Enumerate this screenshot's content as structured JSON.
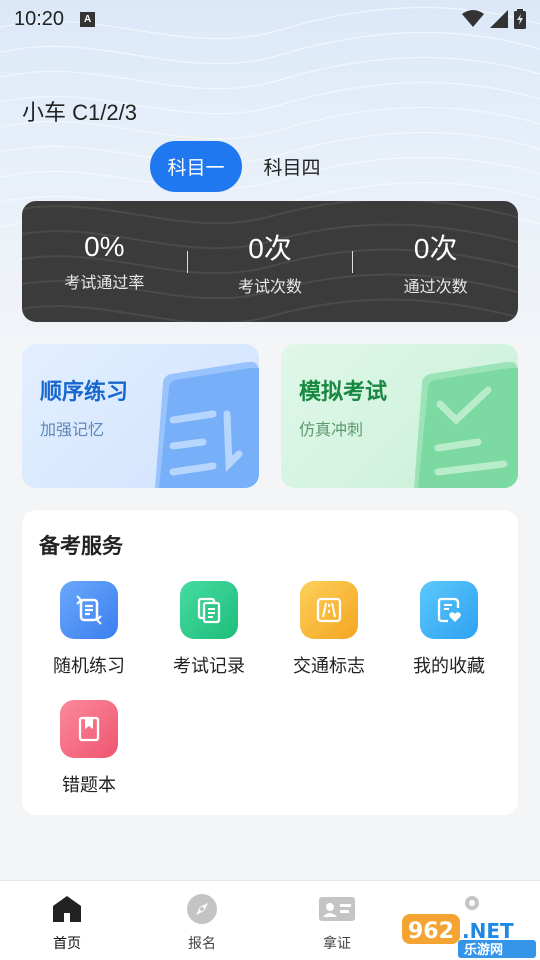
{
  "status_bar": {
    "time": "10:20",
    "notification_letter": "A"
  },
  "header": {
    "license_type": "小车 C1/2/3",
    "subject_tabs": [
      {
        "label": "科目一",
        "active": true
      },
      {
        "label": "科目四",
        "active": false
      }
    ]
  },
  "stats": [
    {
      "value": "0%",
      "label": "考试通过率"
    },
    {
      "value": "0次",
      "label": "考试次数"
    },
    {
      "value": "0次",
      "label": "通过次数"
    }
  ],
  "practice_cards": [
    {
      "title": "顺序练习",
      "subtitle": "加强记忆",
      "theme": "blue"
    },
    {
      "title": "模拟考试",
      "subtitle": "仿真冲刺",
      "theme": "green"
    }
  ],
  "services": {
    "heading": "备考服务",
    "items": [
      {
        "label": "随机练习",
        "icon": "shuffle-icon",
        "color": "#4b8ff5"
      },
      {
        "label": "考试记录",
        "icon": "records-icon",
        "color": "#2fcb8d"
      },
      {
        "label": "交通标志",
        "icon": "road-sign-icon",
        "color": "#f7b733"
      },
      {
        "label": "我的收藏",
        "icon": "favorite-icon",
        "color": "#3fb3f5"
      },
      {
        "label": "错题本",
        "icon": "bookmark-icon",
        "color": "#f4677e"
      }
    ]
  },
  "tabbar": [
    {
      "label": "首页",
      "icon": "home-icon",
      "active": true
    },
    {
      "label": "报名",
      "icon": "compass-icon",
      "active": false
    },
    {
      "label": "拿证",
      "icon": "id-card-icon",
      "active": false
    },
    {
      "label": "",
      "icon": "profile-icon",
      "active": false
    }
  ],
  "watermark": {
    "number_text": "962",
    "domain_text": ".NET",
    "site_name": "乐游网"
  },
  "colors": {
    "accent": "#1f78f0",
    "stats_bg": "#3b3b3b"
  }
}
